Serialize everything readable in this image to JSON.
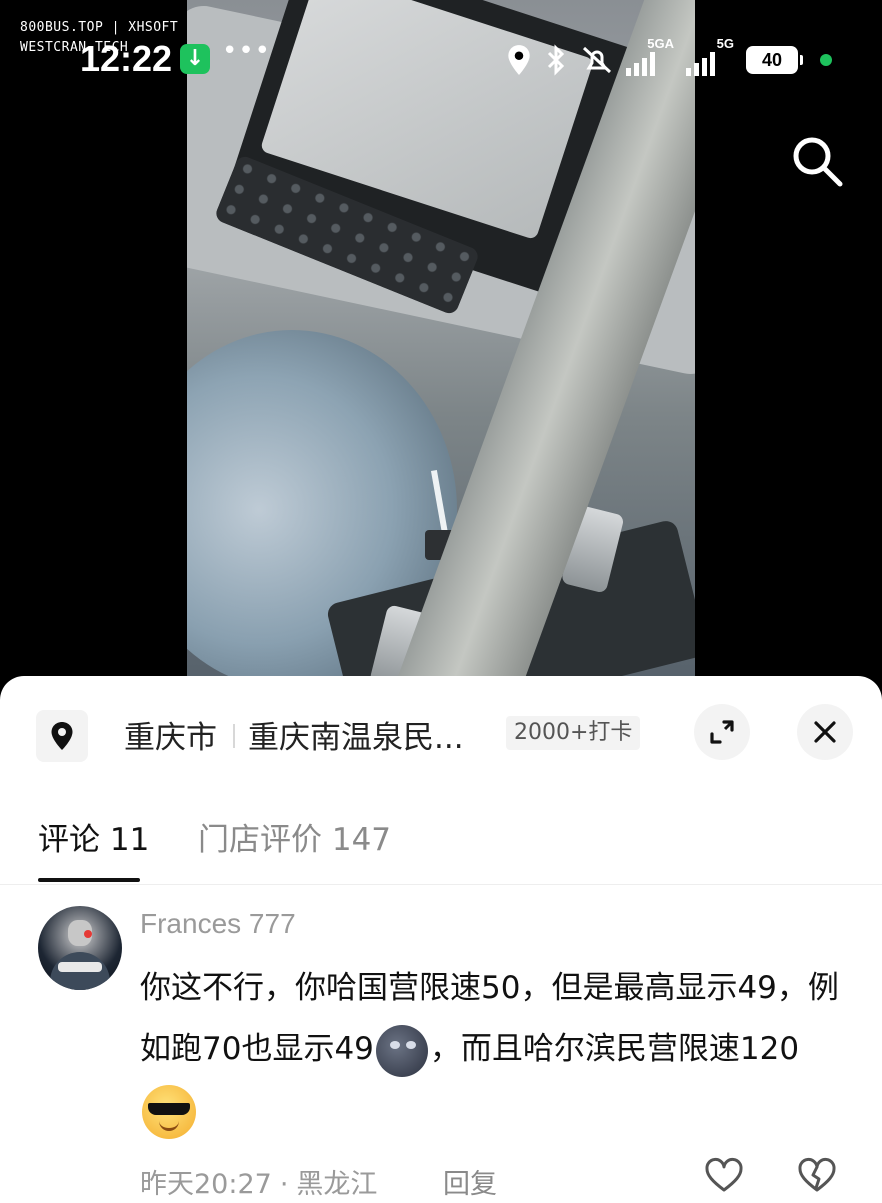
{
  "watermark": {
    "line1": "800BUS.TOP | XHSOFT",
    "line2": "WESTCRAN TECH"
  },
  "status_bar": {
    "time": "12:22",
    "network1": "5GA",
    "network2": "5G",
    "battery": "40"
  },
  "location": {
    "city": "重庆市",
    "place": "重庆南温泉民...",
    "checkins": "2000+打卡"
  },
  "tabs": {
    "comments": "评论 11",
    "reviews": "门店评价 147"
  },
  "comment": {
    "username": "Frances 777",
    "text_part1": "你这不行，你哈国营限速50，但是最高显示49，例如跑70也显示49",
    "text_part2": "，而且哈尔滨民营限速120",
    "time": "昨天20:27",
    "region": "黑龙江",
    "reply_label": "回复"
  },
  "colors": {
    "accent_green": "#1ec25d",
    "sheet_bg": "#ffffff",
    "muted_text": "#9a9a9a"
  },
  "icons": [
    "location-pin-icon",
    "bluetooth-icon",
    "mute-icon",
    "search-icon",
    "expand-icon",
    "close-icon",
    "heart-icon",
    "broken-heart-icon"
  ]
}
